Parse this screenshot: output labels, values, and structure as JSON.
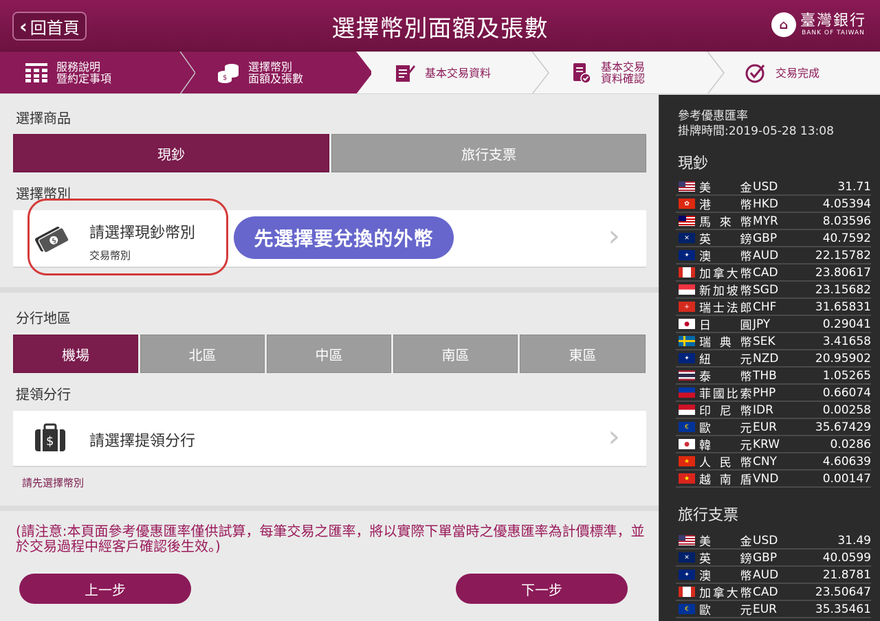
{
  "header": {
    "back_label": "回首頁",
    "title": "選擇幣別面額及張數",
    "logo_zh": "臺灣銀行",
    "logo_en": "BANK OF TAIWAN"
  },
  "steps": [
    {
      "line1": "服務說明",
      "line2": "暨約定事項",
      "icon": "grid-icon",
      "state": "done"
    },
    {
      "line1": "選擇幣別",
      "line2": "面額及張數",
      "icon": "coins-icon",
      "state": "current"
    },
    {
      "line1": "基本交易資料",
      "line2": "",
      "icon": "edit-form-icon",
      "state": "todo"
    },
    {
      "line1": "基本交易",
      "line2": "資料確認",
      "icon": "document-check-icon",
      "state": "todo"
    },
    {
      "line1": "交易完成",
      "line2": "",
      "icon": "checkmark-circle-icon",
      "state": "todo"
    }
  ],
  "product": {
    "label": "選擇商品",
    "options": [
      "現鈔",
      "旅行支票"
    ],
    "selected": "現鈔"
  },
  "currency": {
    "label": "選擇幣別",
    "card_title": "請選擇現鈔幣別",
    "card_sub": "交易幣別",
    "annotation": "先選擇要兌換的外幣"
  },
  "region": {
    "label": "分行地區",
    "options": [
      "機場",
      "北區",
      "中區",
      "南區",
      "東區"
    ],
    "selected": "機場"
  },
  "branch": {
    "label": "提領分行",
    "card_title": "請選擇提領分行",
    "warning": "請先選擇幣別"
  },
  "notice": "(請注意:本頁面參考優惠匯率僅供試算，每筆交易之匯率，將以實際下單當時之優惠匯率為計價標準，並於交易過程中經客戶確認後生效。)",
  "buttons": {
    "prev": "上一步",
    "next": "下一步"
  },
  "rates": {
    "caption1": "參考優惠匯率",
    "caption2": "掛牌時間:2019-05-28 13:08",
    "cash_title": "現鈔",
    "cash": [
      {
        "name": "美金",
        "code": "USD",
        "value": "31.71",
        "flag": "us"
      },
      {
        "name": "港幣",
        "code": "HKD",
        "value": "4.05394",
        "flag": "hk"
      },
      {
        "name": "馬來幣",
        "code": "MYR",
        "value": "8.03596",
        "flag": "my"
      },
      {
        "name": "英鎊",
        "code": "GBP",
        "value": "40.7592",
        "flag": "gb"
      },
      {
        "name": "澳幣",
        "code": "AUD",
        "value": "22.15782",
        "flag": "au"
      },
      {
        "name": "加拿大幣",
        "code": "CAD",
        "value": "23.80617",
        "flag": "ca"
      },
      {
        "name": "新加坡幣",
        "code": "SGD",
        "value": "23.15682",
        "flag": "sg"
      },
      {
        "name": "瑞士法郎",
        "code": "CHF",
        "value": "31.65831",
        "flag": "ch"
      },
      {
        "name": "日圓",
        "code": "JPY",
        "value": "0.29041",
        "flag": "jp"
      },
      {
        "name": "瑞典幣",
        "code": "SEK",
        "value": "3.41658",
        "flag": "se"
      },
      {
        "name": "紐元",
        "code": "NZD",
        "value": "20.95902",
        "flag": "nz"
      },
      {
        "name": "泰幣",
        "code": "THB",
        "value": "1.05265",
        "flag": "th"
      },
      {
        "name": "菲國比索",
        "code": "PHP",
        "value": "0.66074",
        "flag": "ph"
      },
      {
        "name": "印尼幣",
        "code": "IDR",
        "value": "0.00258",
        "flag": "id"
      },
      {
        "name": "歐元",
        "code": "EUR",
        "value": "35.67429",
        "flag": "eu"
      },
      {
        "name": "韓元",
        "code": "KRW",
        "value": "0.0286",
        "flag": "kr"
      },
      {
        "name": "人民幣",
        "code": "CNY",
        "value": "4.60639",
        "flag": "cn"
      },
      {
        "name": "越南盾",
        "code": "VND",
        "value": "0.00147",
        "flag": "vn"
      }
    ],
    "cheque_title": "旅行支票",
    "cheque": [
      {
        "name": "美金",
        "code": "USD",
        "value": "31.49",
        "flag": "us"
      },
      {
        "name": "英鎊",
        "code": "GBP",
        "value": "40.0599",
        "flag": "gb"
      },
      {
        "name": "澳幣",
        "code": "AUD",
        "value": "21.8781",
        "flag": "au"
      },
      {
        "name": "加拿大幣",
        "code": "CAD",
        "value": "23.50647",
        "flag": "ca"
      },
      {
        "name": "歐元",
        "code": "EUR",
        "value": "35.35461",
        "flag": "eu"
      }
    ]
  },
  "colors": {
    "brand": "#8b1a58",
    "annotation": "#6666cc",
    "highlight": "#d53a3a",
    "panel": "#2b2b2b"
  }
}
